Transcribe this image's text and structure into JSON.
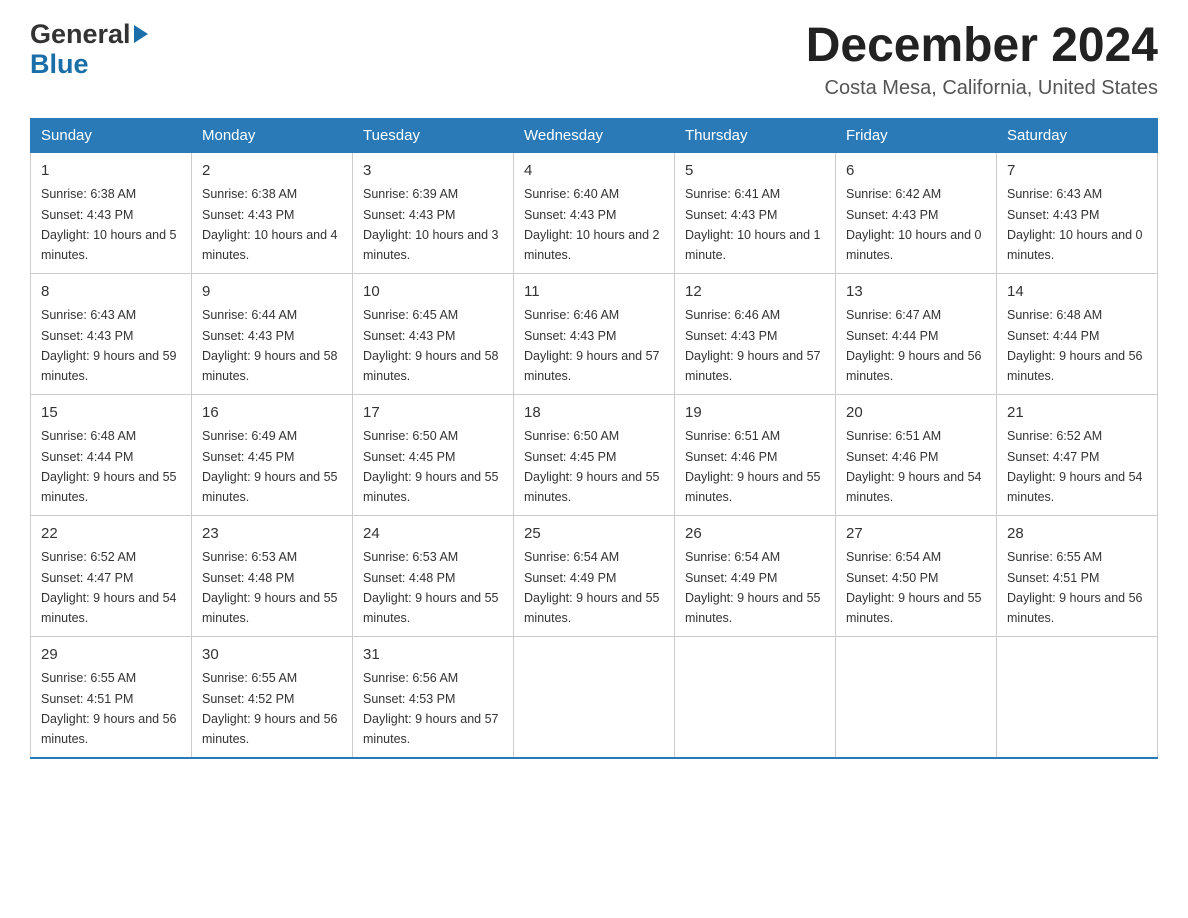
{
  "header": {
    "logo_general": "General",
    "logo_blue": "Blue",
    "title": "December 2024",
    "subtitle": "Costa Mesa, California, United States"
  },
  "days_of_week": [
    "Sunday",
    "Monday",
    "Tuesday",
    "Wednesday",
    "Thursday",
    "Friday",
    "Saturday"
  ],
  "weeks": [
    [
      {
        "num": "1",
        "sunrise": "6:38 AM",
        "sunset": "4:43 PM",
        "daylight": "10 hours and 5 minutes."
      },
      {
        "num": "2",
        "sunrise": "6:38 AM",
        "sunset": "4:43 PM",
        "daylight": "10 hours and 4 minutes."
      },
      {
        "num": "3",
        "sunrise": "6:39 AM",
        "sunset": "4:43 PM",
        "daylight": "10 hours and 3 minutes."
      },
      {
        "num": "4",
        "sunrise": "6:40 AM",
        "sunset": "4:43 PM",
        "daylight": "10 hours and 2 minutes."
      },
      {
        "num": "5",
        "sunrise": "6:41 AM",
        "sunset": "4:43 PM",
        "daylight": "10 hours and 1 minute."
      },
      {
        "num": "6",
        "sunrise": "6:42 AM",
        "sunset": "4:43 PM",
        "daylight": "10 hours and 0 minutes."
      },
      {
        "num": "7",
        "sunrise": "6:43 AM",
        "sunset": "4:43 PM",
        "daylight": "10 hours and 0 minutes."
      }
    ],
    [
      {
        "num": "8",
        "sunrise": "6:43 AM",
        "sunset": "4:43 PM",
        "daylight": "9 hours and 59 minutes."
      },
      {
        "num": "9",
        "sunrise": "6:44 AM",
        "sunset": "4:43 PM",
        "daylight": "9 hours and 58 minutes."
      },
      {
        "num": "10",
        "sunrise": "6:45 AM",
        "sunset": "4:43 PM",
        "daylight": "9 hours and 58 minutes."
      },
      {
        "num": "11",
        "sunrise": "6:46 AM",
        "sunset": "4:43 PM",
        "daylight": "9 hours and 57 minutes."
      },
      {
        "num": "12",
        "sunrise": "6:46 AM",
        "sunset": "4:43 PM",
        "daylight": "9 hours and 57 minutes."
      },
      {
        "num": "13",
        "sunrise": "6:47 AM",
        "sunset": "4:44 PM",
        "daylight": "9 hours and 56 minutes."
      },
      {
        "num": "14",
        "sunrise": "6:48 AM",
        "sunset": "4:44 PM",
        "daylight": "9 hours and 56 minutes."
      }
    ],
    [
      {
        "num": "15",
        "sunrise": "6:48 AM",
        "sunset": "4:44 PM",
        "daylight": "9 hours and 55 minutes."
      },
      {
        "num": "16",
        "sunrise": "6:49 AM",
        "sunset": "4:45 PM",
        "daylight": "9 hours and 55 minutes."
      },
      {
        "num": "17",
        "sunrise": "6:50 AM",
        "sunset": "4:45 PM",
        "daylight": "9 hours and 55 minutes."
      },
      {
        "num": "18",
        "sunrise": "6:50 AM",
        "sunset": "4:45 PM",
        "daylight": "9 hours and 55 minutes."
      },
      {
        "num": "19",
        "sunrise": "6:51 AM",
        "sunset": "4:46 PM",
        "daylight": "9 hours and 55 minutes."
      },
      {
        "num": "20",
        "sunrise": "6:51 AM",
        "sunset": "4:46 PM",
        "daylight": "9 hours and 54 minutes."
      },
      {
        "num": "21",
        "sunrise": "6:52 AM",
        "sunset": "4:47 PM",
        "daylight": "9 hours and 54 minutes."
      }
    ],
    [
      {
        "num": "22",
        "sunrise": "6:52 AM",
        "sunset": "4:47 PM",
        "daylight": "9 hours and 54 minutes."
      },
      {
        "num": "23",
        "sunrise": "6:53 AM",
        "sunset": "4:48 PM",
        "daylight": "9 hours and 55 minutes."
      },
      {
        "num": "24",
        "sunrise": "6:53 AM",
        "sunset": "4:48 PM",
        "daylight": "9 hours and 55 minutes."
      },
      {
        "num": "25",
        "sunrise": "6:54 AM",
        "sunset": "4:49 PM",
        "daylight": "9 hours and 55 minutes."
      },
      {
        "num": "26",
        "sunrise": "6:54 AM",
        "sunset": "4:49 PM",
        "daylight": "9 hours and 55 minutes."
      },
      {
        "num": "27",
        "sunrise": "6:54 AM",
        "sunset": "4:50 PM",
        "daylight": "9 hours and 55 minutes."
      },
      {
        "num": "28",
        "sunrise": "6:55 AM",
        "sunset": "4:51 PM",
        "daylight": "9 hours and 56 minutes."
      }
    ],
    [
      {
        "num": "29",
        "sunrise": "6:55 AM",
        "sunset": "4:51 PM",
        "daylight": "9 hours and 56 minutes."
      },
      {
        "num": "30",
        "sunrise": "6:55 AM",
        "sunset": "4:52 PM",
        "daylight": "9 hours and 56 minutes."
      },
      {
        "num": "31",
        "sunrise": "6:56 AM",
        "sunset": "4:53 PM",
        "daylight": "9 hours and 57 minutes."
      },
      null,
      null,
      null,
      null
    ]
  ]
}
